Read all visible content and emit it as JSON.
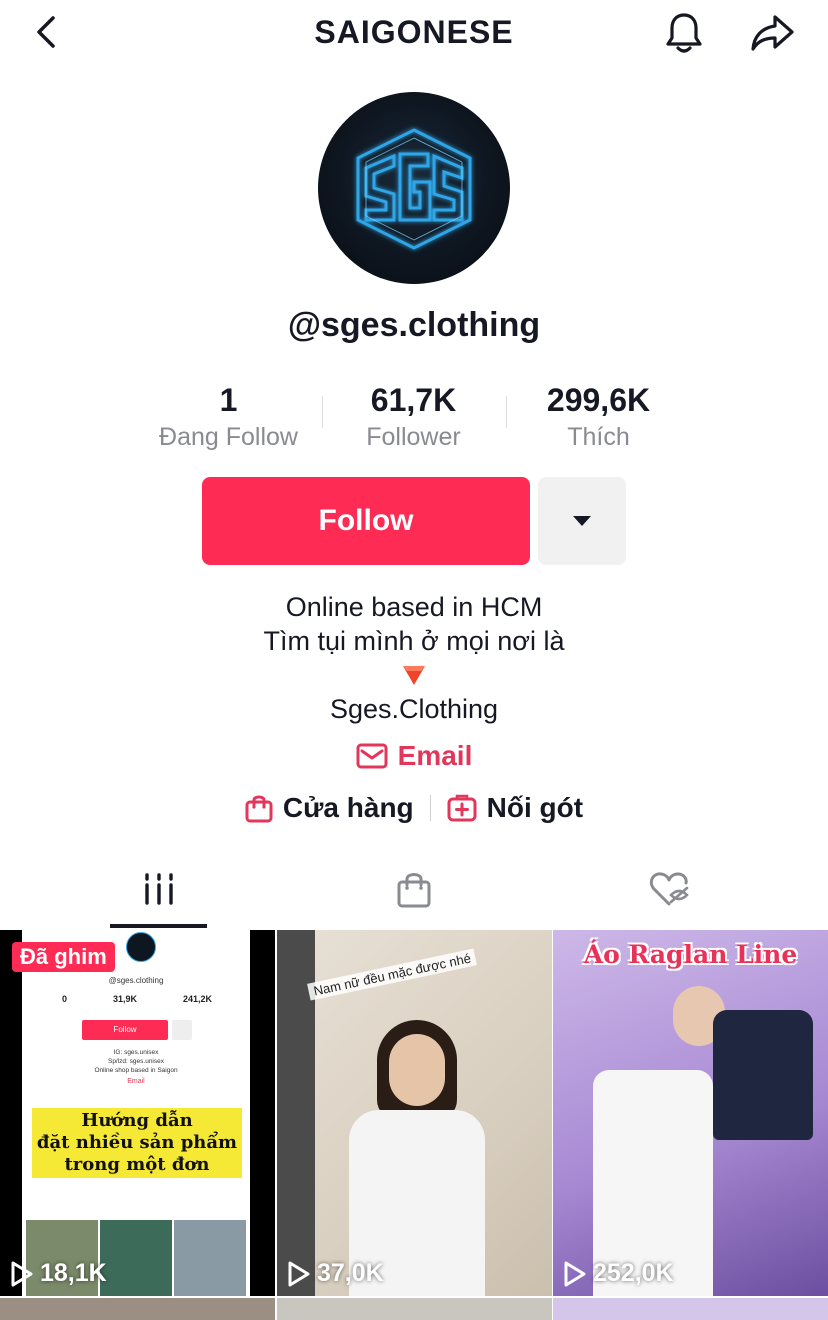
{
  "header": {
    "title": "SAIGONESE",
    "back_icon": "chevron-left-icon",
    "bell_icon": "bell-icon",
    "share_icon": "share-arrow-icon"
  },
  "profile": {
    "username": "@sges.clothing",
    "avatar_text": "SGES",
    "stats": [
      {
        "value": "1",
        "label": "Đang Follow"
      },
      {
        "value": "61,7K",
        "label": "Follower"
      },
      {
        "value": "299,6K",
        "label": "Thích"
      }
    ],
    "follow_label": "Follow",
    "bio_lines": [
      "Online based in HCM",
      "Tìm tụi mình ở mọi nơi là",
      "Sges.Clothing"
    ],
    "email_label": "Email",
    "shop_label": "Cửa hàng",
    "noigot_label": "Nối gót"
  },
  "tabs": [
    {
      "name": "videos",
      "icon": "grid-icon",
      "active": true
    },
    {
      "name": "shop",
      "icon": "shopping-bag-icon",
      "active": false
    },
    {
      "name": "liked",
      "icon": "hidden-heart-icon",
      "active": false
    }
  ],
  "videos": [
    {
      "views": "18,1K",
      "pinned_label": "Đã ghim",
      "inner_username": "@sges.clothing",
      "inner_stats": [
        "0",
        "31,9K",
        "241,2K"
      ],
      "inner_follow": "Follow",
      "inner_bio": [
        "IG: sges.unisex",
        "Sp/lzd: sges.unisex",
        "Online shop based in Saigon"
      ],
      "inner_email": "Email",
      "caption": [
        "Hướng dẫn",
        "đặt nhiều sản phẩm",
        "trong một đơn"
      ]
    },
    {
      "views": "37,0K",
      "caption": "Nam nữ đều mặc được nhé"
    },
    {
      "views": "252,0K",
      "caption": "Áo Raglan Line"
    }
  ],
  "colors": {
    "accent": "#fe2c55",
    "email": "#e1375b",
    "muted": "#8a8b91",
    "text": "#161823"
  }
}
